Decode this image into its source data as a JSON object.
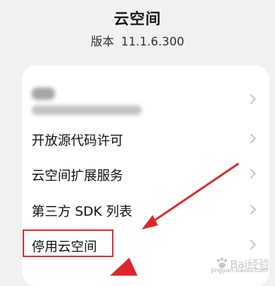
{
  "header": {
    "title": "云空间",
    "version_label": "版本",
    "version_number": "11.1.6.300"
  },
  "menu": {
    "items": [
      {
        "label": "开放源代码许可"
      },
      {
        "label": "云空间扩展服务"
      },
      {
        "label": "第三方 SDK 列表"
      },
      {
        "label": "停用云空间"
      }
    ]
  },
  "colors": {
    "annotation": "#e0262b",
    "background": "#f1f1f1",
    "card": "#ffffff"
  },
  "watermark": {
    "text": "Bai经验",
    "sub": "jingyan.baidu.com"
  }
}
